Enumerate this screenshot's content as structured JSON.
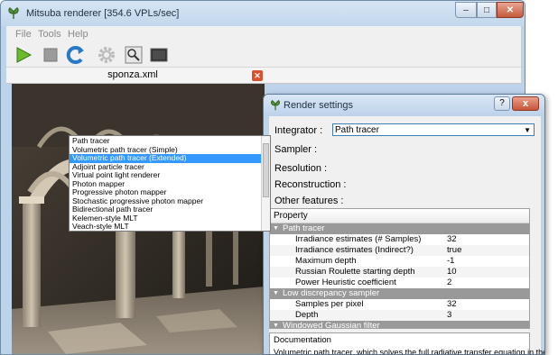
{
  "main_window": {
    "title": "Mitsuba renderer [354.6 VPLs/sec]",
    "menu": [
      "File",
      "Tools",
      "Help"
    ],
    "toolbar_icons": [
      "play-icon",
      "stop-icon",
      "refresh-icon",
      "gear-icon",
      "magnifier-icon",
      "image-icon"
    ],
    "tab": {
      "label": "sponza.xml"
    }
  },
  "dialog": {
    "title": "Render settings",
    "help_label": "?",
    "close_label": "x",
    "form": {
      "integrator_label": "Integrator :",
      "integrator_value": "Path tracer",
      "sampler_label": "Sampler :",
      "resolution_label": "Resolution :",
      "reconstruction_label": "Reconstruction :",
      "other_label": "Other features :"
    },
    "integrator_options": [
      "Path tracer",
      "Volumetric path tracer (Simple)",
      "Volumetric path tracer (Extended)",
      "Adjoint particle tracer",
      "Virtual point light renderer",
      "Photon mapper",
      "Progressive photon mapper",
      "Stochastic progressive photon mapper",
      "Bidirectional path tracer",
      "Kelemen-style MLT",
      "Veach-style MLT"
    ],
    "selected_option_index": 2,
    "property_header": "Property",
    "groups": [
      {
        "name": "Path tracer",
        "rows": [
          {
            "name": "Irradiance estimates (# Samples)",
            "value": "32"
          },
          {
            "name": "Irradiance estimates (Indirect?)",
            "value": "true"
          },
          {
            "name": "Maximum depth",
            "value": "-1"
          },
          {
            "name": "Russian Roulette starting depth",
            "value": "10"
          },
          {
            "name": "Power Heuristic coefficient",
            "value": "2"
          }
        ]
      },
      {
        "name": "Low discrepancy sampler",
        "rows": [
          {
            "name": "Samples per pixel",
            "value": "32"
          },
          {
            "name": "Depth",
            "value": "3"
          }
        ]
      },
      {
        "name": "Windowed Gaussian filter",
        "rows": []
      }
    ],
    "documentation_label": "Documentation",
    "documentation_text": "Volumetric path tracer, which solves the full radiative transfer equation in the"
  },
  "colors": {
    "window_frame": "#bcd3ea",
    "selection": "#3399ff",
    "group_header": "#999999"
  }
}
